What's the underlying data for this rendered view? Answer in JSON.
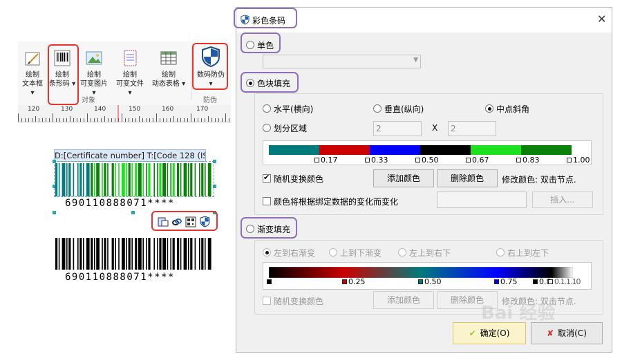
{
  "ribbon": {
    "buttons": [
      {
        "line1": "绘制",
        "line2": "文本框"
      },
      {
        "line1": "绘制",
        "line2": "条形码"
      },
      {
        "line1": "绘制",
        "line2": "可变图片"
      },
      {
        "line1": "绘制",
        "line2": "可变文件"
      },
      {
        "line1": "绘制",
        "line2": "动态表格"
      },
      {
        "line1": "数码防伪",
        "line2": ""
      }
    ],
    "group_object": "对象",
    "group_security": "防伪",
    "ruler_marks": [
      "120",
      "130",
      "140",
      "150",
      "160",
      "170"
    ]
  },
  "canvas": {
    "selected_label": "D:[Certificate number] T:[Code 128 (IS...",
    "barcode_text_1": "690110888071****",
    "barcode_text_2": "690110888071****"
  },
  "dialog": {
    "title": "彩色条码",
    "close": "✕",
    "mono_label": "单色",
    "block_label": "色块填充",
    "horizontal": "水平(横向)",
    "vertical": "垂直(纵向)",
    "center_diag": "中点斜角",
    "divide": "划分区域",
    "divide_x": "2",
    "x_sep": "X",
    "divide_y": "2",
    "block_stops": [
      "0.17",
      "0.33",
      "0.50",
      "0.67",
      "0.83",
      "1.00"
    ],
    "random_color": "随机变换颜色",
    "add_color": "添加颜色",
    "delete_color": "删除颜色",
    "modify_hint": "修改颜色: 双击节点.",
    "follow_data": "颜色将根据绑定数据的变化而变化",
    "insert": "插入...",
    "gradient_label": "渐变填充",
    "grad_lr": "左到右渐变",
    "grad_tb": "上到下渐变",
    "grad_tl": "左上到右下",
    "grad_tr": "右上到左下",
    "grad_stops": [
      "0.25",
      "0.50",
      "0.75",
      "0.8"
    ],
    "grad_stops_clutter": "0.1.1.10",
    "grad_random": "随机变换颜色",
    "grad_add": "添加颜色",
    "grad_delete": "删除颜色",
    "grad_hint": "修改颜色: 双击节点.",
    "ok": "确定(O)",
    "cancel": "取消(C)"
  },
  "watermark": "Bai 经验",
  "colors": {
    "teal": "#007b7b",
    "red": "#cc0000",
    "blue": "#0000ff",
    "black": "#000000",
    "lime": "#1fe01f",
    "green": "#0a820a",
    "highlight_red": "#e8322e",
    "highlight_purple": "#8e6dbb"
  }
}
